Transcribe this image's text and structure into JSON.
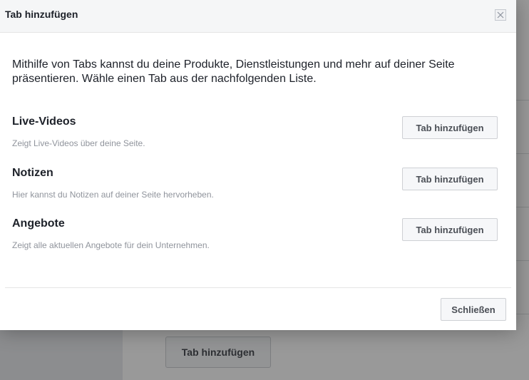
{
  "dialog": {
    "title": "Tab hinzufügen",
    "intro": "Mithilfe von Tabs kannst du deine Produkte, Dienstleistungen und mehr auf deiner Seite präsentieren. Wähle einen Tab aus der nachfolgenden Liste.",
    "close_icon": "close-icon",
    "tabs": [
      {
        "name": "Live-Videos",
        "description": "Zeigt Live-Videos über deine Seite.",
        "button_label": "Tab hinzufügen"
      },
      {
        "name": "Notizen",
        "description": "Hier kannst du Notizen auf deiner Seite hervorheben.",
        "button_label": "Tab hinzufügen"
      },
      {
        "name": "Angebote",
        "description": "Zeigt alle aktuellen Angebote für dein Unternehmen.",
        "button_label": "Tab hinzufügen"
      }
    ],
    "footer_close_label": "Schließen"
  },
  "background": {
    "add_tab_button_label": "Tab hinzufügen"
  }
}
